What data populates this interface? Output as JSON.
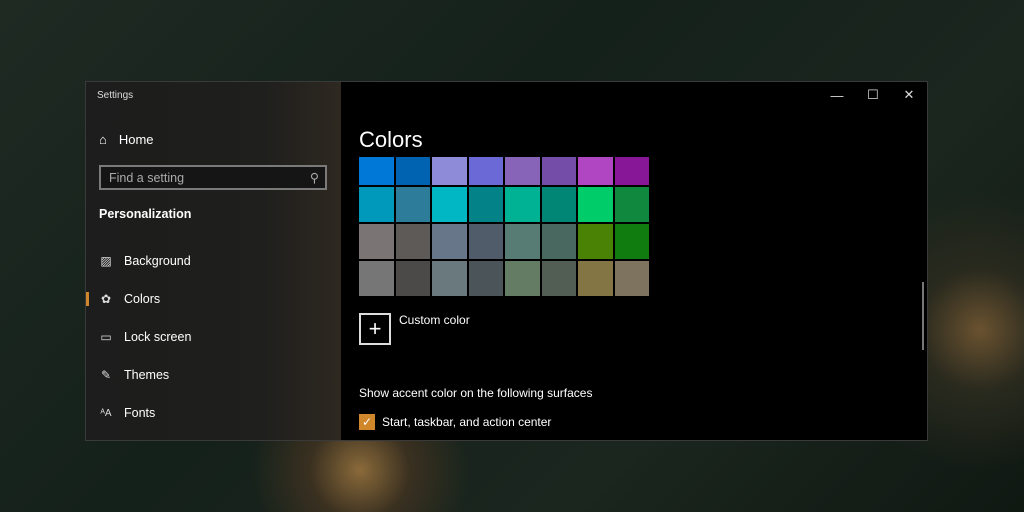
{
  "window": {
    "title": "Settings",
    "minimize": "—",
    "maximize": "☐",
    "close": "✕"
  },
  "sidebar": {
    "home": "Home",
    "search_placeholder": "Find a setting",
    "section": "Personalization",
    "items": [
      {
        "label": "Background",
        "icon": "🖼"
      },
      {
        "label": "Colors",
        "icon": "🎨",
        "selected": true
      },
      {
        "label": "Lock screen",
        "icon": "▭"
      },
      {
        "label": "Themes",
        "icon": "✎"
      },
      {
        "label": "Fonts",
        "icon": "ᴬA"
      }
    ]
  },
  "main": {
    "title": "Colors",
    "custom_color": "Custom color",
    "surfaces_heading": "Show accent color on the following surfaces",
    "checkbox_label": "Start, taskbar, and action center",
    "checkbox_checked": true,
    "accent": "#d0862a",
    "swatches": [
      "#0078d7",
      "#0063b1",
      "#8e8cd8",
      "#6b69d6",
      "#8764b8",
      "#744da9",
      "#b146c2",
      "#881798",
      "#0099bc",
      "#2d7d9a",
      "#00b7c3",
      "#038387",
      "#00b294",
      "#018574",
      "#00cc6a",
      "#10893e",
      "#7a7574",
      "#5d5a58",
      "#68768a",
      "#515c6b",
      "#567c73",
      "#486860",
      "#498205",
      "#107c10",
      "#767676",
      "#4c4a48",
      "#69797e",
      "#4a5459",
      "#647c64",
      "#525e54",
      "#847545",
      "#7e735f"
    ]
  }
}
